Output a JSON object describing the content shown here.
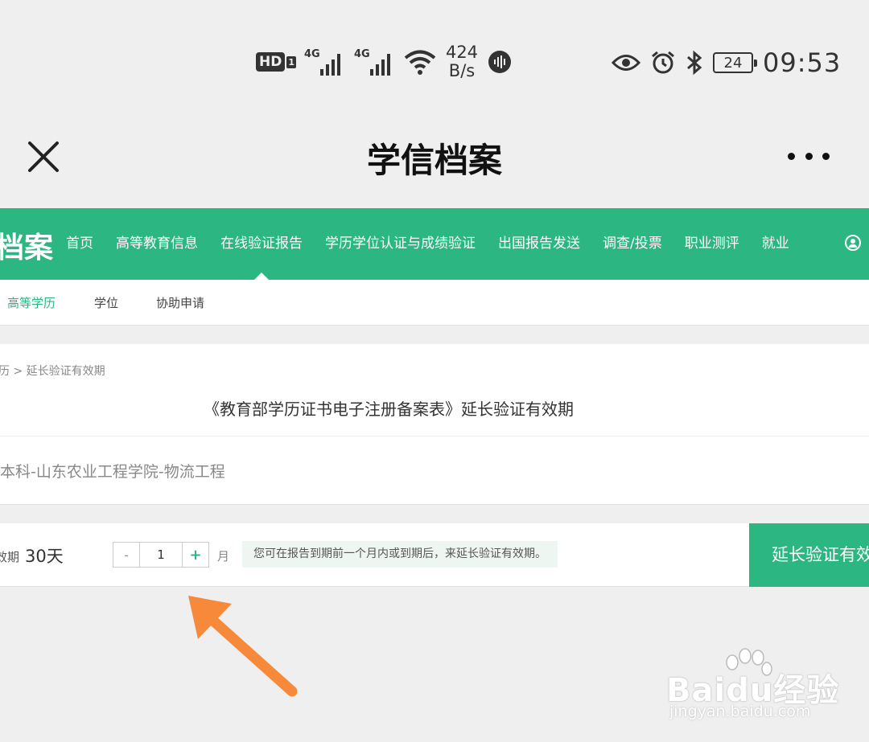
{
  "statusbar": {
    "hd_label": "HD",
    "hd_sim": "1",
    "network_1": "4G",
    "network_2": "4G",
    "speed_value": "424",
    "speed_unit": "B/s",
    "battery_level": "24",
    "time": "09:53"
  },
  "titlebar": {
    "title": "学信档案"
  },
  "nav": {
    "logo_text": "档案",
    "items": [
      "首页",
      "高等教育信息",
      "在线验证报告",
      "学历学位认证与成绩验证",
      "出国报告发送",
      "调查/投票",
      "职业测评",
      "就业"
    ],
    "active_index": 2,
    "accent_color": "#2bb682"
  },
  "subnav": {
    "tabs": [
      "高等学历",
      "学位",
      "协助申请"
    ],
    "active_index": 0
  },
  "card1": {
    "breadcrumb_prev": "历",
    "breadcrumb_sep": " > ",
    "breadcrumb_current": "延长验证有效期",
    "title": "《教育部学历证书电子注册备案表》延长验证有效期",
    "record": "本科-山东农业工程学院-物流工程"
  },
  "card2": {
    "remain_label": "效期",
    "remain_value": "30天",
    "minus_label": "-",
    "months_value": "1",
    "plus_label": "+",
    "unit": "月",
    "hint": "您可在报告到期前一个月内或到期后，来延长验证有效期。",
    "extend_button": "延长验证有效期"
  },
  "watermark": {
    "brand": "Baidu经验",
    "url": "jingyan.baidu.com"
  }
}
